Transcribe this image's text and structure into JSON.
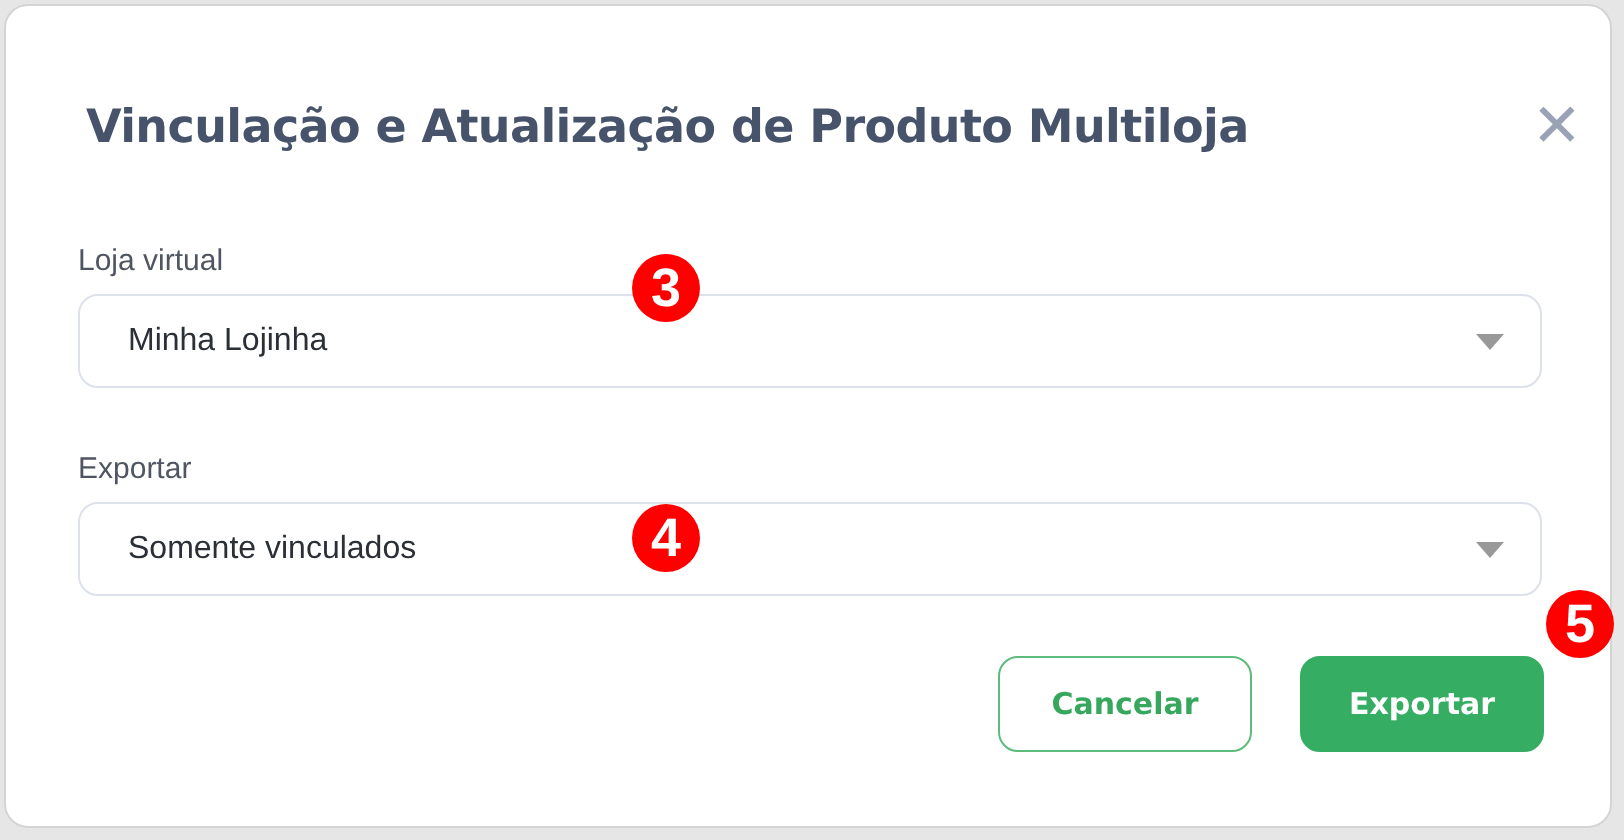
{
  "dialog": {
    "title": "Vinculação e Atualização de Produto Multiloja",
    "close_icon": "✕"
  },
  "fields": [
    {
      "label": "Loja virtual",
      "value": "Minha Lojinha"
    },
    {
      "label": "Exportar",
      "value": "Somente vinculados"
    }
  ],
  "buttons": [
    {
      "label": "Cancelar",
      "kind": "secondary"
    },
    {
      "label": "Exportar",
      "kind": "primary"
    }
  ],
  "annotations": [
    {
      "label": "3"
    },
    {
      "label": "4"
    },
    {
      "label": "5"
    }
  ]
}
